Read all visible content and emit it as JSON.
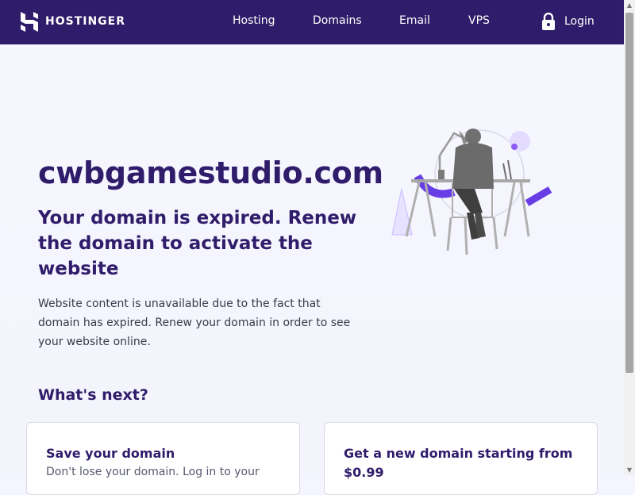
{
  "header": {
    "brand": "HOSTINGER",
    "nav": [
      "Hosting",
      "Domains",
      "Email",
      "VPS"
    ],
    "login": "Login"
  },
  "hero": {
    "domain": "cwbgamestudio.com",
    "heading": "Your domain is expired. Renew the domain to activate the website",
    "description": "Website content is unavailable due to the fact that domain has expired. Renew your domain in order to see your website online."
  },
  "next": {
    "heading": "What's next?",
    "cards": [
      {
        "title": "Save your domain",
        "text": "Don't lose your domain. Log in to your"
      },
      {
        "title": "Get a new domain starting from $0.99",
        "text": ""
      }
    ]
  },
  "colors": {
    "brand_dark": "#2f1c6a",
    "accent": "#673de6",
    "background": "#f4f5ff"
  },
  "icons": [
    "hostinger-logo-icon",
    "lock-icon",
    "scroll-up-arrow-icon",
    "scroll-down-arrow-icon"
  ]
}
